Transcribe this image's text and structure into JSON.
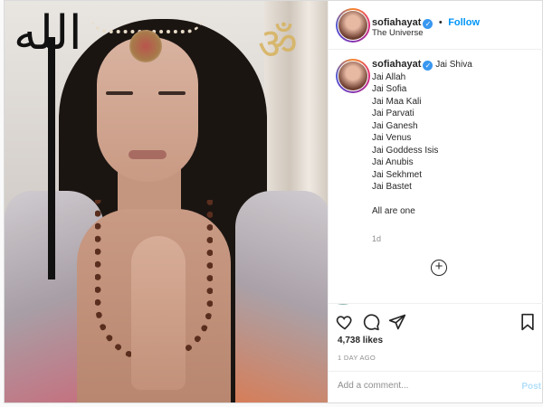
{
  "post": {
    "username": "sofiahayat",
    "follow_label": "Follow",
    "location": "The Universe",
    "caption_first": "Jai Shiva",
    "caption_lines": [
      "Jai Allah",
      "Jai Sofia",
      "Jai Maa Kali",
      "Jai Parvati",
      "Jai Ganesh",
      "Jai Venus",
      "Jai Goddess Isis",
      "Jai Anubis",
      "Jai Sekhmet",
      "Jai Bastet",
      "",
      "All are one"
    ],
    "time_ago": "1d",
    "likes": "4,738 likes",
    "date": "1 DAY AGO",
    "comment_placeholder": "Add a comment...",
    "post_label": "Post",
    "separator": "•",
    "arabic_text": "الله",
    "om_symbol": "ॐ"
  },
  "icons": {
    "like": "heart-icon",
    "comment": "comment-icon",
    "share": "share-icon",
    "save": "bookmark-icon",
    "more_comments": "plus-circle-icon",
    "verified": "verified-badge-icon"
  },
  "colors": {
    "accent": "#0095f6",
    "verified": "#3897f0",
    "text": "#262626",
    "muted": "#8e8e8e"
  }
}
